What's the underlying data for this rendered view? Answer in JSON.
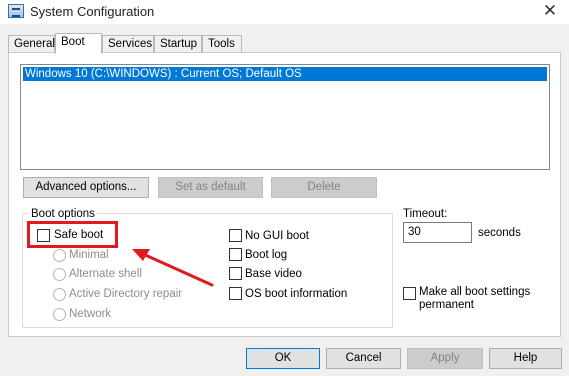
{
  "window": {
    "title": "System Configuration",
    "icon": "msconfig-icon",
    "close_glyph": "✕"
  },
  "tabs": [
    {
      "label": "General"
    },
    {
      "label": "Boot"
    },
    {
      "label": "Services"
    },
    {
      "label": "Startup"
    },
    {
      "label": "Tools"
    }
  ],
  "active_tab": "Boot",
  "os_list": {
    "items": [
      "Windows 10 (C:\\WINDOWS) : Current OS; Default OS"
    ]
  },
  "buttons": {
    "advanced_options": "Advanced options...",
    "set_as_default": "Set as default",
    "delete": "Delete"
  },
  "boot_options": {
    "label": "Boot options",
    "safe_boot": {
      "label": "Safe boot",
      "checked": false
    },
    "safe_modes": [
      {
        "label": "Minimal"
      },
      {
        "label": "Alternate shell"
      },
      {
        "label": "Active Directory repair"
      },
      {
        "label": "Network"
      }
    ],
    "right_options": [
      {
        "label": "No GUI boot",
        "checked": false
      },
      {
        "label": "Boot log",
        "checked": false
      },
      {
        "label": "Base video",
        "checked": false
      },
      {
        "label": "OS boot information",
        "checked": false
      }
    ]
  },
  "timeout": {
    "label": "Timeout:",
    "value": "30",
    "unit": "seconds"
  },
  "make_permanent": {
    "label_line1": "Make all boot settings",
    "label_line2": "permanent",
    "checked": false
  },
  "dialog_buttons": {
    "ok": "OK",
    "cancel": "Cancel",
    "apply": "Apply",
    "help": "Help"
  },
  "annotation_color": "#e0191f"
}
